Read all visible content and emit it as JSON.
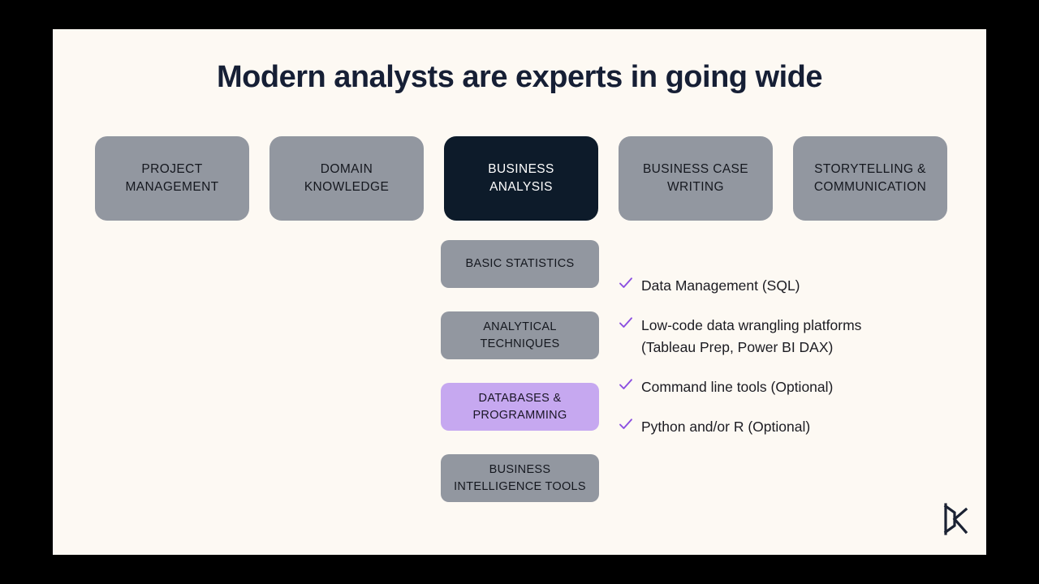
{
  "slide": {
    "title": "Modern analysts are experts in going wide",
    "background_color": "#FDF9F3",
    "stage_color": "#000000"
  },
  "palette": {
    "box_grey": "#9297A0",
    "box_active_navy": "#0D1B2A",
    "box_highlight_purple": "#C6A8F0",
    "title_navy": "#161F35",
    "check_purple": "#8B4FE0",
    "body_text": "#1C1C22",
    "logo_navy": "#1B2233"
  },
  "top_row": {
    "items": [
      {
        "id": "project-management",
        "line1": "PROJECT",
        "line2": "MANAGEMENT",
        "state": "default"
      },
      {
        "id": "domain-knowledge",
        "line1": "DOMAIN",
        "line2": "KNOWLEDGE",
        "state": "default"
      },
      {
        "id": "business-analysis",
        "line1": "BUSINESS",
        "line2": "ANALYSIS",
        "state": "active"
      },
      {
        "id": "business-case-writing",
        "line1": "BUSINESS CASE",
        "line2": "WRITING",
        "state": "default"
      },
      {
        "id": "storytelling-communication",
        "line1": "STORYTELLING &",
        "line2": "COMMUNICATION",
        "state": "default"
      }
    ]
  },
  "sub_column": {
    "items": [
      {
        "id": "basic-statistics",
        "line1": "BASIC STATISTICS",
        "line2": "",
        "state": "default"
      },
      {
        "id": "analytical-techniques",
        "line1": "ANALYTICAL",
        "line2": "TECHNIQUES",
        "state": "default"
      },
      {
        "id": "databases-programming",
        "line1": "DATABASES &",
        "line2": "PROGRAMMING",
        "state": "highlighted"
      },
      {
        "id": "business-intelligence-tools",
        "line1": "BUSINESS",
        "line2": "INTELLIGENCE TOOLS",
        "state": "default"
      }
    ]
  },
  "bullets": {
    "icon": "check-icon",
    "items": [
      {
        "id": "data-management",
        "line1": "Data Management (SQL)",
        "line2": ""
      },
      {
        "id": "low-code-platforms",
        "line1": "Low-code data wrangling platforms",
        "line2": "(Tableau Prep, Power BI DAX)"
      },
      {
        "id": "command-line-tools",
        "line1": "Command line tools (Optional)",
        "line2": ""
      },
      {
        "id": "python-r",
        "line1": "Python and/or R (Optional)",
        "line2": ""
      }
    ]
  },
  "logo": {
    "name": "dk-monogram-logo",
    "alt_text": "DK"
  }
}
